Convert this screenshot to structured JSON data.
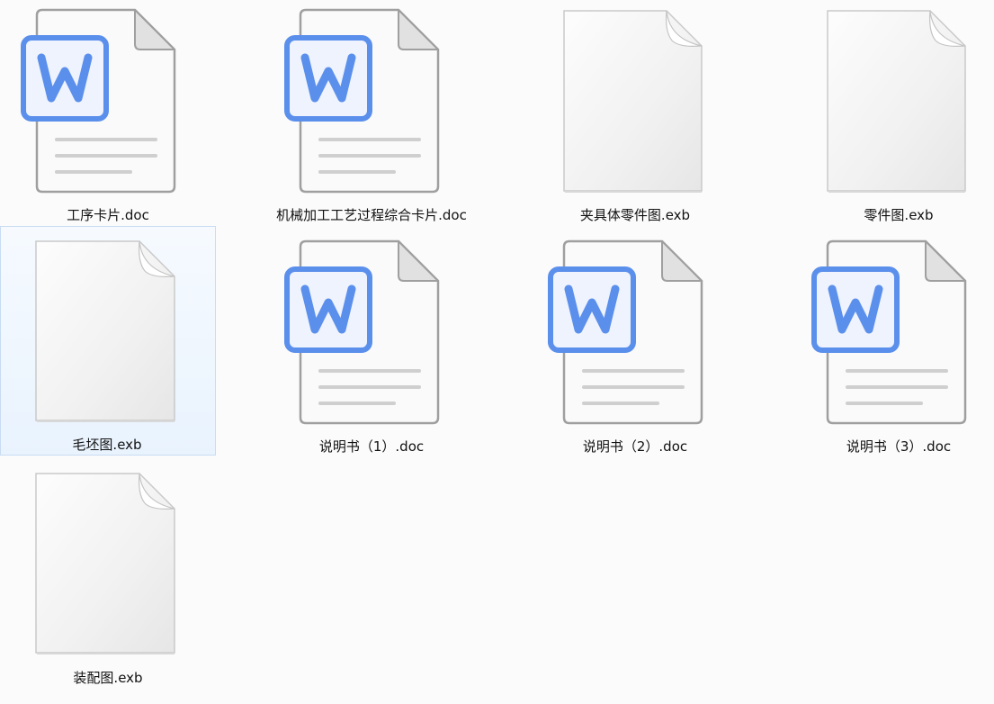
{
  "window": {
    "view": "large-icons"
  },
  "files": [
    {
      "name": "工序卡片.doc",
      "icon": "word-doc-icon",
      "selected": false
    },
    {
      "name": "机械加工工艺过程综合卡片.doc",
      "icon": "word-doc-icon",
      "selected": false
    },
    {
      "name": "夹具体零件图.exb",
      "icon": "blank-file-icon",
      "selected": false
    },
    {
      "name": "零件图.exb",
      "icon": "blank-file-icon",
      "selected": false
    },
    {
      "name": "毛坯图.exb",
      "icon": "blank-file-icon",
      "selected": true
    },
    {
      "name": "说明书（1）.doc",
      "icon": "word-doc-icon",
      "selected": false
    },
    {
      "name": "说明书（2）.doc",
      "icon": "word-doc-icon",
      "selected": false
    },
    {
      "name": "说明书（3）.doc",
      "icon": "word-doc-icon",
      "selected": false
    },
    {
      "name": "装配图.exb",
      "icon": "blank-file-icon",
      "selected": false
    }
  ],
  "colors": {
    "word_blue": "#5b8fec",
    "selection_bg": "#e9f3fe",
    "selection_border": "#c8dcf2"
  }
}
